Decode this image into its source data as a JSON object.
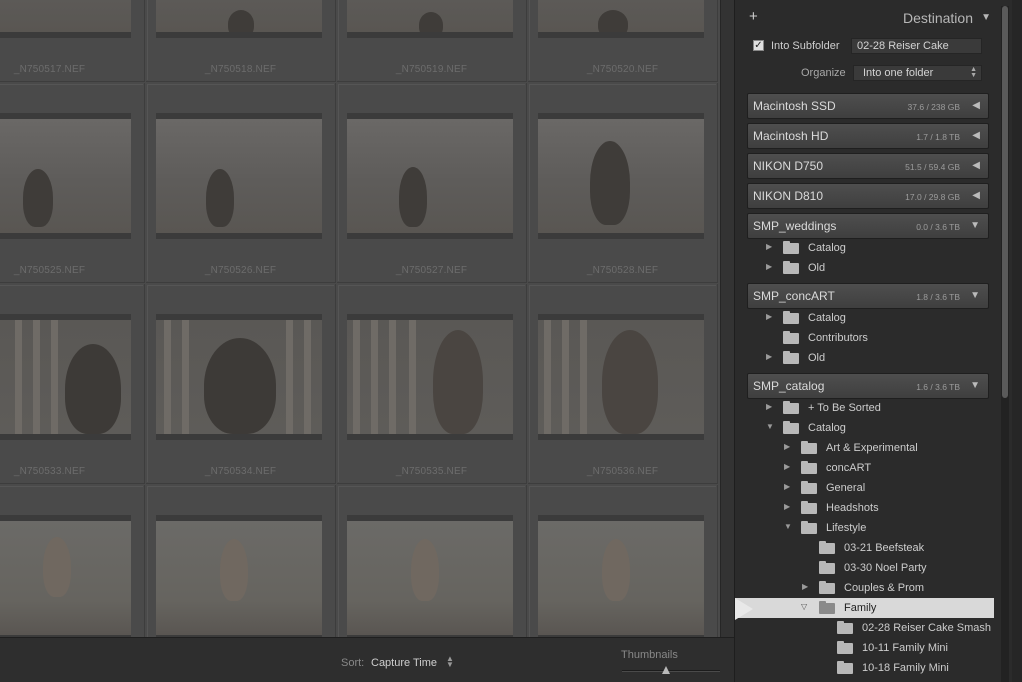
{
  "grid": {
    "rows": [
      [
        "_N750517.NEF",
        "_N750518.NEF",
        "_N750519.NEF",
        "_N750520.NEF"
      ],
      [
        "_N750525.NEF",
        "_N750526.NEF",
        "_N750527.NEF",
        "_N750528.NEF"
      ],
      [
        "_N750533.NEF",
        "_N750534.NEF",
        "_N750535.NEF",
        "_N750536.NEF"
      ],
      [
        "",
        "",
        "",
        ""
      ]
    ]
  },
  "toolbar": {
    "sort_label": "Sort:",
    "sort_value": "Capture Time",
    "thumbnails_label": "Thumbnails",
    "thumbnail_size_fraction": 0.45
  },
  "panel": {
    "title": "Destination",
    "into_subfolder_label": "Into Subfolder",
    "into_subfolder_checked": true,
    "subfolder_value": "02-28 Reiser Cake",
    "organize_label": "Organize",
    "organize_value": "Into one folder",
    "volumes": [
      {
        "name": "Macintosh SSD",
        "size": "37.6 / 238 GB"
      },
      {
        "name": "Macintosh HD",
        "size": "1.7 / 1.8 TB"
      },
      {
        "name": "NIKON D750",
        "size": "51.5 / 59.4 GB"
      },
      {
        "name": "NIKON D810",
        "size": "17.0 / 29.8 GB"
      },
      {
        "name": "SMP_weddings",
        "size": "0.0 / 3.6 TB"
      },
      {
        "name": "SMP_concART",
        "size": "1.8 / 3.6 TB"
      },
      {
        "name": "SMP_catalog",
        "size": "1.6 / 3.6 TB"
      }
    ],
    "folders": [
      {
        "label": "Catalog"
      },
      {
        "label": "Old"
      },
      {
        "label": "Catalog"
      },
      {
        "label": "Contributors"
      },
      {
        "label": "Old"
      },
      {
        "label": "+ To Be Sorted"
      },
      {
        "label": "Catalog"
      },
      {
        "label": "Art & Experimental"
      },
      {
        "label": "concART"
      },
      {
        "label": "General"
      },
      {
        "label": "Headshots"
      },
      {
        "label": "Lifestyle"
      },
      {
        "label": "03-21 Beefsteak"
      },
      {
        "label": "03-30 Noel Party"
      },
      {
        "label": "Couples & Prom"
      },
      {
        "label": "Family"
      },
      {
        "label": "02-28 Reiser Cake Smash"
      },
      {
        "label": "10-11 Family Mini"
      },
      {
        "label": "10-18 Family Mini"
      }
    ]
  }
}
